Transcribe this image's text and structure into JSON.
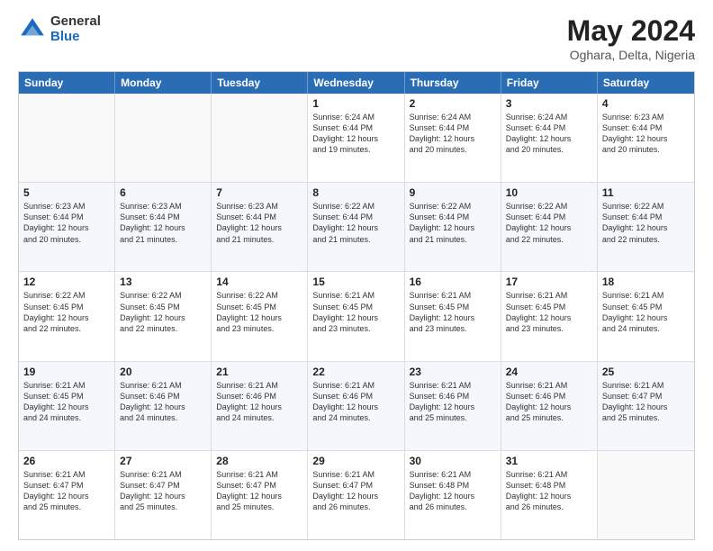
{
  "header": {
    "logo_general": "General",
    "logo_blue": "Blue",
    "month_year": "May 2024",
    "location": "Oghara, Delta, Nigeria"
  },
  "days_of_week": [
    "Sunday",
    "Monday",
    "Tuesday",
    "Wednesday",
    "Thursday",
    "Friday",
    "Saturday"
  ],
  "weeks": [
    [
      {
        "day": "",
        "info": ""
      },
      {
        "day": "",
        "info": ""
      },
      {
        "day": "",
        "info": ""
      },
      {
        "day": "1",
        "info": "Sunrise: 6:24 AM\nSunset: 6:44 PM\nDaylight: 12 hours\nand 19 minutes."
      },
      {
        "day": "2",
        "info": "Sunrise: 6:24 AM\nSunset: 6:44 PM\nDaylight: 12 hours\nand 20 minutes."
      },
      {
        "day": "3",
        "info": "Sunrise: 6:24 AM\nSunset: 6:44 PM\nDaylight: 12 hours\nand 20 minutes."
      },
      {
        "day": "4",
        "info": "Sunrise: 6:23 AM\nSunset: 6:44 PM\nDaylight: 12 hours\nand 20 minutes."
      }
    ],
    [
      {
        "day": "5",
        "info": "Sunrise: 6:23 AM\nSunset: 6:44 PM\nDaylight: 12 hours\nand 20 minutes."
      },
      {
        "day": "6",
        "info": "Sunrise: 6:23 AM\nSunset: 6:44 PM\nDaylight: 12 hours\nand 21 minutes."
      },
      {
        "day": "7",
        "info": "Sunrise: 6:23 AM\nSunset: 6:44 PM\nDaylight: 12 hours\nand 21 minutes."
      },
      {
        "day": "8",
        "info": "Sunrise: 6:22 AM\nSunset: 6:44 PM\nDaylight: 12 hours\nand 21 minutes."
      },
      {
        "day": "9",
        "info": "Sunrise: 6:22 AM\nSunset: 6:44 PM\nDaylight: 12 hours\nand 21 minutes."
      },
      {
        "day": "10",
        "info": "Sunrise: 6:22 AM\nSunset: 6:44 PM\nDaylight: 12 hours\nand 22 minutes."
      },
      {
        "day": "11",
        "info": "Sunrise: 6:22 AM\nSunset: 6:44 PM\nDaylight: 12 hours\nand 22 minutes."
      }
    ],
    [
      {
        "day": "12",
        "info": "Sunrise: 6:22 AM\nSunset: 6:45 PM\nDaylight: 12 hours\nand 22 minutes."
      },
      {
        "day": "13",
        "info": "Sunrise: 6:22 AM\nSunset: 6:45 PM\nDaylight: 12 hours\nand 22 minutes."
      },
      {
        "day": "14",
        "info": "Sunrise: 6:22 AM\nSunset: 6:45 PM\nDaylight: 12 hours\nand 23 minutes."
      },
      {
        "day": "15",
        "info": "Sunrise: 6:21 AM\nSunset: 6:45 PM\nDaylight: 12 hours\nand 23 minutes."
      },
      {
        "day": "16",
        "info": "Sunrise: 6:21 AM\nSunset: 6:45 PM\nDaylight: 12 hours\nand 23 minutes."
      },
      {
        "day": "17",
        "info": "Sunrise: 6:21 AM\nSunset: 6:45 PM\nDaylight: 12 hours\nand 23 minutes."
      },
      {
        "day": "18",
        "info": "Sunrise: 6:21 AM\nSunset: 6:45 PM\nDaylight: 12 hours\nand 24 minutes."
      }
    ],
    [
      {
        "day": "19",
        "info": "Sunrise: 6:21 AM\nSunset: 6:45 PM\nDaylight: 12 hours\nand 24 minutes."
      },
      {
        "day": "20",
        "info": "Sunrise: 6:21 AM\nSunset: 6:46 PM\nDaylight: 12 hours\nand 24 minutes."
      },
      {
        "day": "21",
        "info": "Sunrise: 6:21 AM\nSunset: 6:46 PM\nDaylight: 12 hours\nand 24 minutes."
      },
      {
        "day": "22",
        "info": "Sunrise: 6:21 AM\nSunset: 6:46 PM\nDaylight: 12 hours\nand 24 minutes."
      },
      {
        "day": "23",
        "info": "Sunrise: 6:21 AM\nSunset: 6:46 PM\nDaylight: 12 hours\nand 25 minutes."
      },
      {
        "day": "24",
        "info": "Sunrise: 6:21 AM\nSunset: 6:46 PM\nDaylight: 12 hours\nand 25 minutes."
      },
      {
        "day": "25",
        "info": "Sunrise: 6:21 AM\nSunset: 6:47 PM\nDaylight: 12 hours\nand 25 minutes."
      }
    ],
    [
      {
        "day": "26",
        "info": "Sunrise: 6:21 AM\nSunset: 6:47 PM\nDaylight: 12 hours\nand 25 minutes."
      },
      {
        "day": "27",
        "info": "Sunrise: 6:21 AM\nSunset: 6:47 PM\nDaylight: 12 hours\nand 25 minutes."
      },
      {
        "day": "28",
        "info": "Sunrise: 6:21 AM\nSunset: 6:47 PM\nDaylight: 12 hours\nand 25 minutes."
      },
      {
        "day": "29",
        "info": "Sunrise: 6:21 AM\nSunset: 6:47 PM\nDaylight: 12 hours\nand 26 minutes."
      },
      {
        "day": "30",
        "info": "Sunrise: 6:21 AM\nSunset: 6:48 PM\nDaylight: 12 hours\nand 26 minutes."
      },
      {
        "day": "31",
        "info": "Sunrise: 6:21 AM\nSunset: 6:48 PM\nDaylight: 12 hours\nand 26 minutes."
      },
      {
        "day": "",
        "info": ""
      }
    ]
  ]
}
